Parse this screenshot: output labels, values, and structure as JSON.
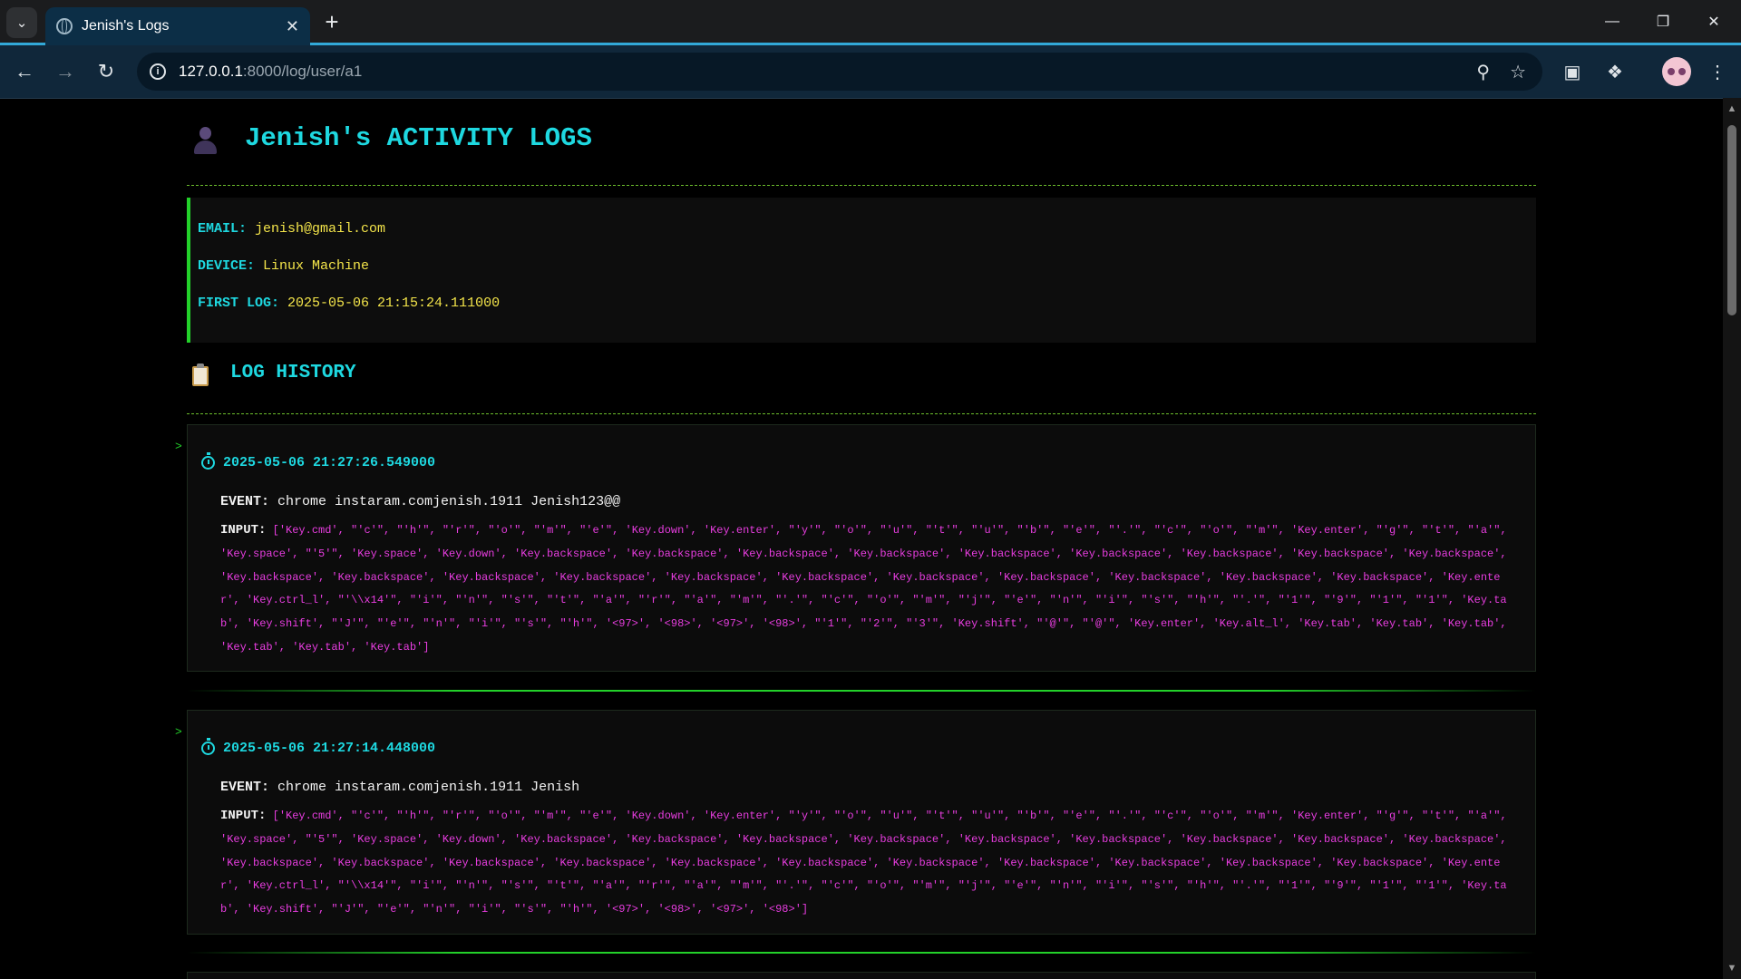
{
  "browser": {
    "tab_title": "Jenish's Logs",
    "url_host": "127.0.0.1",
    "url_rest": ":8000/log/user/a1"
  },
  "page": {
    "title": "Jenish's ACTIVITY LOGS",
    "info": {
      "email_label": "EMAIL:",
      "email": "jenish@gmail.com",
      "device_label": "DEVICE:",
      "device": "Linux Machine",
      "first_log_label": "FIRST LOG:",
      "first_log": "2025-05-06 21:15:24.111000"
    },
    "history_title": "LOG HISTORY",
    "logs": [
      {
        "arrow": ">",
        "time": "2025-05-06 21:27:26.549000",
        "event_label": "EVENT:",
        "event": "chrome instaram.comjenish.1911 Jenish123@@",
        "input_label": "INPUT:",
        "input": "['Key.cmd', \"'c'\", \"'h'\", \"'r'\", \"'o'\", \"'m'\", \"'e'\", 'Key.down', 'Key.enter', \"'y'\", \"'o'\", \"'u'\", \"'t'\", \"'u'\", \"'b'\", \"'e'\", \"'.'\", \"'c'\", \"'o'\", \"'m'\", 'Key.enter', \"'g'\", \"'t'\", \"'a'\", 'Key.space', \"'5'\", 'Key.space', 'Key.down', 'Key.backspace', 'Key.backspace', 'Key.backspace', 'Key.backspace', 'Key.backspace', 'Key.backspace', 'Key.backspace', 'Key.backspace', 'Key.backspace', 'Key.backspace', 'Key.backspace', 'Key.backspace', 'Key.backspace', 'Key.backspace', 'Key.backspace', 'Key.backspace', 'Key.backspace', 'Key.backspace', 'Key.backspace', 'Key.backspace', 'Key.enter', 'Key.ctrl_l', \"'\\\\x14'\", \"'i'\", \"'n'\", \"'s'\", \"'t'\", \"'a'\", \"'r'\", \"'a'\", \"'m'\", \"'.'\", \"'c'\", \"'o'\", \"'m'\", \"'j'\", \"'e'\", \"'n'\", \"'i'\", \"'s'\", \"'h'\", \"'.'\", \"'1'\", \"'9'\", \"'1'\", \"'1'\", 'Key.tab', 'Key.shift', \"'J'\", \"'e'\", \"'n'\", \"'i'\", \"'s'\", \"'h'\", '<97>', '<98>', '<97>', '<98>', \"'1'\", \"'2'\", \"'3'\", 'Key.shift', \"'@'\", \"'@'\", 'Key.enter', 'Key.alt_l', 'Key.tab', 'Key.tab', 'Key.tab', 'Key.tab', 'Key.tab', 'Key.tab']"
      },
      {
        "arrow": ">",
        "time": "2025-05-06 21:27:14.448000",
        "event_label": "EVENT:",
        "event": "chrome instaram.comjenish.1911 Jenish",
        "input_label": "INPUT:",
        "input": "['Key.cmd', \"'c'\", \"'h'\", \"'r'\", \"'o'\", \"'m'\", \"'e'\", 'Key.down', 'Key.enter', \"'y'\", \"'o'\", \"'u'\", \"'t'\", \"'u'\", \"'b'\", \"'e'\", \"'.'\", \"'c'\", \"'o'\", \"'m'\", 'Key.enter', \"'g'\", \"'t'\", \"'a'\", 'Key.space', \"'5'\", 'Key.space', 'Key.down', 'Key.backspace', 'Key.backspace', 'Key.backspace', 'Key.backspace', 'Key.backspace', 'Key.backspace', 'Key.backspace', 'Key.backspace', 'Key.backspace', 'Key.backspace', 'Key.backspace', 'Key.backspace', 'Key.backspace', 'Key.backspace', 'Key.backspace', 'Key.backspace', 'Key.backspace', 'Key.backspace', 'Key.backspace', 'Key.backspace', 'Key.enter', 'Key.ctrl_l', \"'\\\\x14'\", \"'i'\", \"'n'\", \"'s'\", \"'t'\", \"'a'\", \"'r'\", \"'a'\", \"'m'\", \"'.'\", \"'c'\", \"'o'\", \"'m'\", \"'j'\", \"'e'\", \"'n'\", \"'i'\", \"'s'\", \"'h'\", \"'.'\", \"'1'\", \"'9'\", \"'1'\", \"'1'\", 'Key.tab', 'Key.shift', \"'J'\", \"'e'\", \"'n'\", \"'i'\", \"'s'\", \"'h'\", '<97>', '<98>', '<97>', '<98>']"
      }
    ]
  },
  "colors": {
    "accent_cyan": "#1ed8e0",
    "accent_green": "#23d12a",
    "value_yellow": "#f3e44a",
    "input_magenta": "#e83de0"
  },
  "icons": [
    "tab-search-icon",
    "globe-icon",
    "close-icon",
    "plus-icon",
    "minimize-icon",
    "restore-icon",
    "window-close-icon",
    "back-arrow-icon",
    "forward-arrow-icon",
    "reload-icon",
    "info-icon",
    "zoom-icon",
    "star-icon",
    "cast-icon",
    "extensions-icon",
    "more-icon",
    "user-icon",
    "clipboard-icon",
    "stopwatch-icon"
  ]
}
